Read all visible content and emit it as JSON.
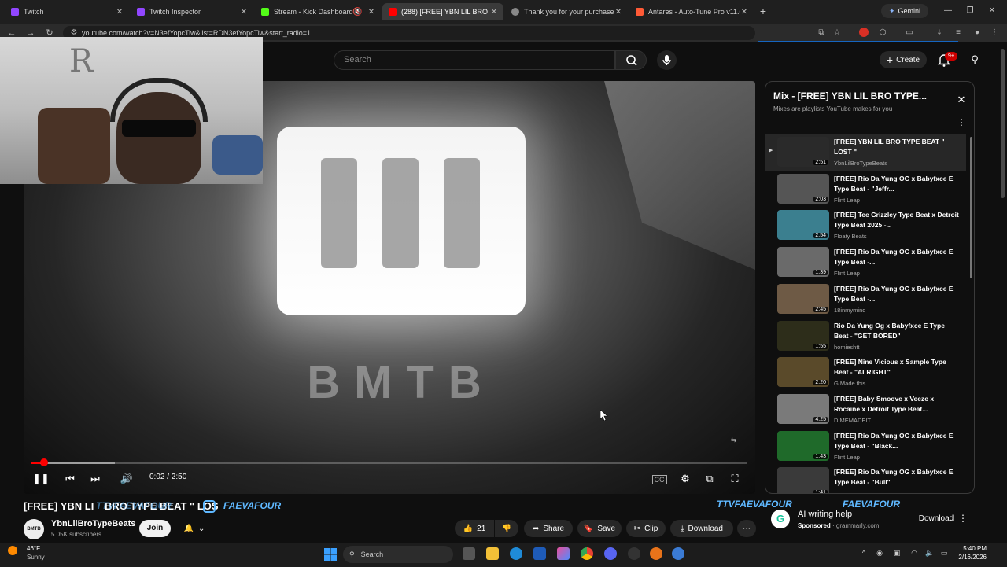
{
  "browser": {
    "tabs": [
      {
        "label": "Twitch",
        "color": "#9146ff",
        "active": false
      },
      {
        "label": "Twitch Inspector",
        "color": "#9146ff",
        "active": false
      },
      {
        "label": "Stream - Kick Dashboard",
        "color": "#53fc18",
        "active": false
      },
      {
        "label": "(288) [FREE] YBN LIL BRO T",
        "color": "#ff0000",
        "active": true
      },
      {
        "label": "Thank you for your purchase! -",
        "color": "#888888",
        "active": false
      },
      {
        "label": "Antares - Auto-Tune Pro v11.0.",
        "color": "#ff5a36",
        "active": false
      }
    ],
    "gemini_label": "Gemini",
    "url": "youtube.com/watch?v=N3efYopcTiw&list=RDN3efYopcTiw&start_radio=1"
  },
  "yt_header": {
    "search_placeholder": "Search",
    "create_label": "Create",
    "notif_count": "9+"
  },
  "player": {
    "current_time": "0:02",
    "duration": "2:50",
    "time_display": "0:02 / 2:50",
    "progress_fraction": 0.012,
    "buffered_fraction": 0.116
  },
  "video": {
    "title_visible_start": "[FREE] YBN LI",
    "title_visible_end": "BRO TYPE BEAT \" LOS",
    "channel_name": "YbnLilBroTypeBeats",
    "subscribers": "5.05K subscribers",
    "join_label": "Join",
    "like_count": "21",
    "share_label": "Share",
    "save_label": "Save",
    "clip_label": "Clip",
    "download_label": "Download"
  },
  "stream_overlays": {
    "tag_left_1": "TTVFAEVAFOUR",
    "tag_left_2": "FAEVAFOUR",
    "tag_right_1": "TTVFAEVAFOUR",
    "tag_right_2": "FAEVAFOUR"
  },
  "playlist": {
    "title": "Mix - [FREE] YBN LIL BRO TYPE...",
    "subtitle": "Mixes are playlists YouTube makes for you",
    "items": [
      {
        "title": "[FREE] YBN LIL BRO TYPE BEAT \" LOST \"",
        "artist": "YbnLilBroTypeBeats",
        "duration": "2:51",
        "thumb": "#2a2a2a",
        "current": true
      },
      {
        "title": "[FREE] Rio Da Yung OG x Babyfxce E Type Beat - \"Jeffr...",
        "artist": "Flint Leap",
        "duration": "2:03",
        "thumb": "#555555",
        "current": false
      },
      {
        "title": "[FREE] Tee Grizzley Type Beat x Detroit Type Beat 2025 -...",
        "artist": "Floaty Beats",
        "duration": "2:54",
        "thumb": "#3b7f8f",
        "current": false
      },
      {
        "title": "[FREE] Rio Da Yung OG x Babyfxce E Type Beat -...",
        "artist": "Flint Leap",
        "duration": "1:39",
        "thumb": "#6a6a6a",
        "current": false
      },
      {
        "title": "[FREE] Rio Da Yung OG x Babyfxce E Type Beat -...",
        "artist": "18inmymind",
        "duration": "2:45",
        "thumb": "#6e5a45",
        "current": false
      },
      {
        "title": "Rio Da Yung Og x Babyfxce E Type Beat - \"GET BORED\"",
        "artist": "homieshtt",
        "duration": "1:55",
        "thumb": "#2d2d1a",
        "current": false
      },
      {
        "title": "[FREE] Nine Vicious x Sample Type Beat - \"ALRIGHT\"",
        "artist": "G Made this",
        "duration": "2:20",
        "thumb": "#5a4a2a",
        "current": false
      },
      {
        "title": "[FREE] Baby Smoove x Veeze x Rocaine x Detroit Type Beat...",
        "artist": "DIMEMADEIT",
        "duration": "4:25",
        "thumb": "#7a7a7a",
        "current": false
      },
      {
        "title": "[FREE] Rio Da Yung OG x Babyfxce E Type Beat - \"Black...",
        "artist": "Flint Leap",
        "duration": "1:43",
        "thumb": "#1f6a2a",
        "current": false
      },
      {
        "title": "[FREE] Rio Da Yung OG x Babyfxce E Type Beat - \"Bull\"",
        "artist": "",
        "duration": "1:41",
        "thumb": "#3a3a3a",
        "current": false
      }
    ]
  },
  "ad": {
    "title": "AI writing help",
    "sponsored": "Sponsored",
    "domain": "grammarly.com",
    "button": "Download"
  },
  "taskbar": {
    "weather_temp": "46°F",
    "weather_cond": "Sunny",
    "search_label": "Search",
    "time": "5:40 PM",
    "date": "2/16/2026"
  },
  "video_frame": {
    "logo_text": "BMTB"
  },
  "webcam": {
    "wall_letter": "R"
  }
}
